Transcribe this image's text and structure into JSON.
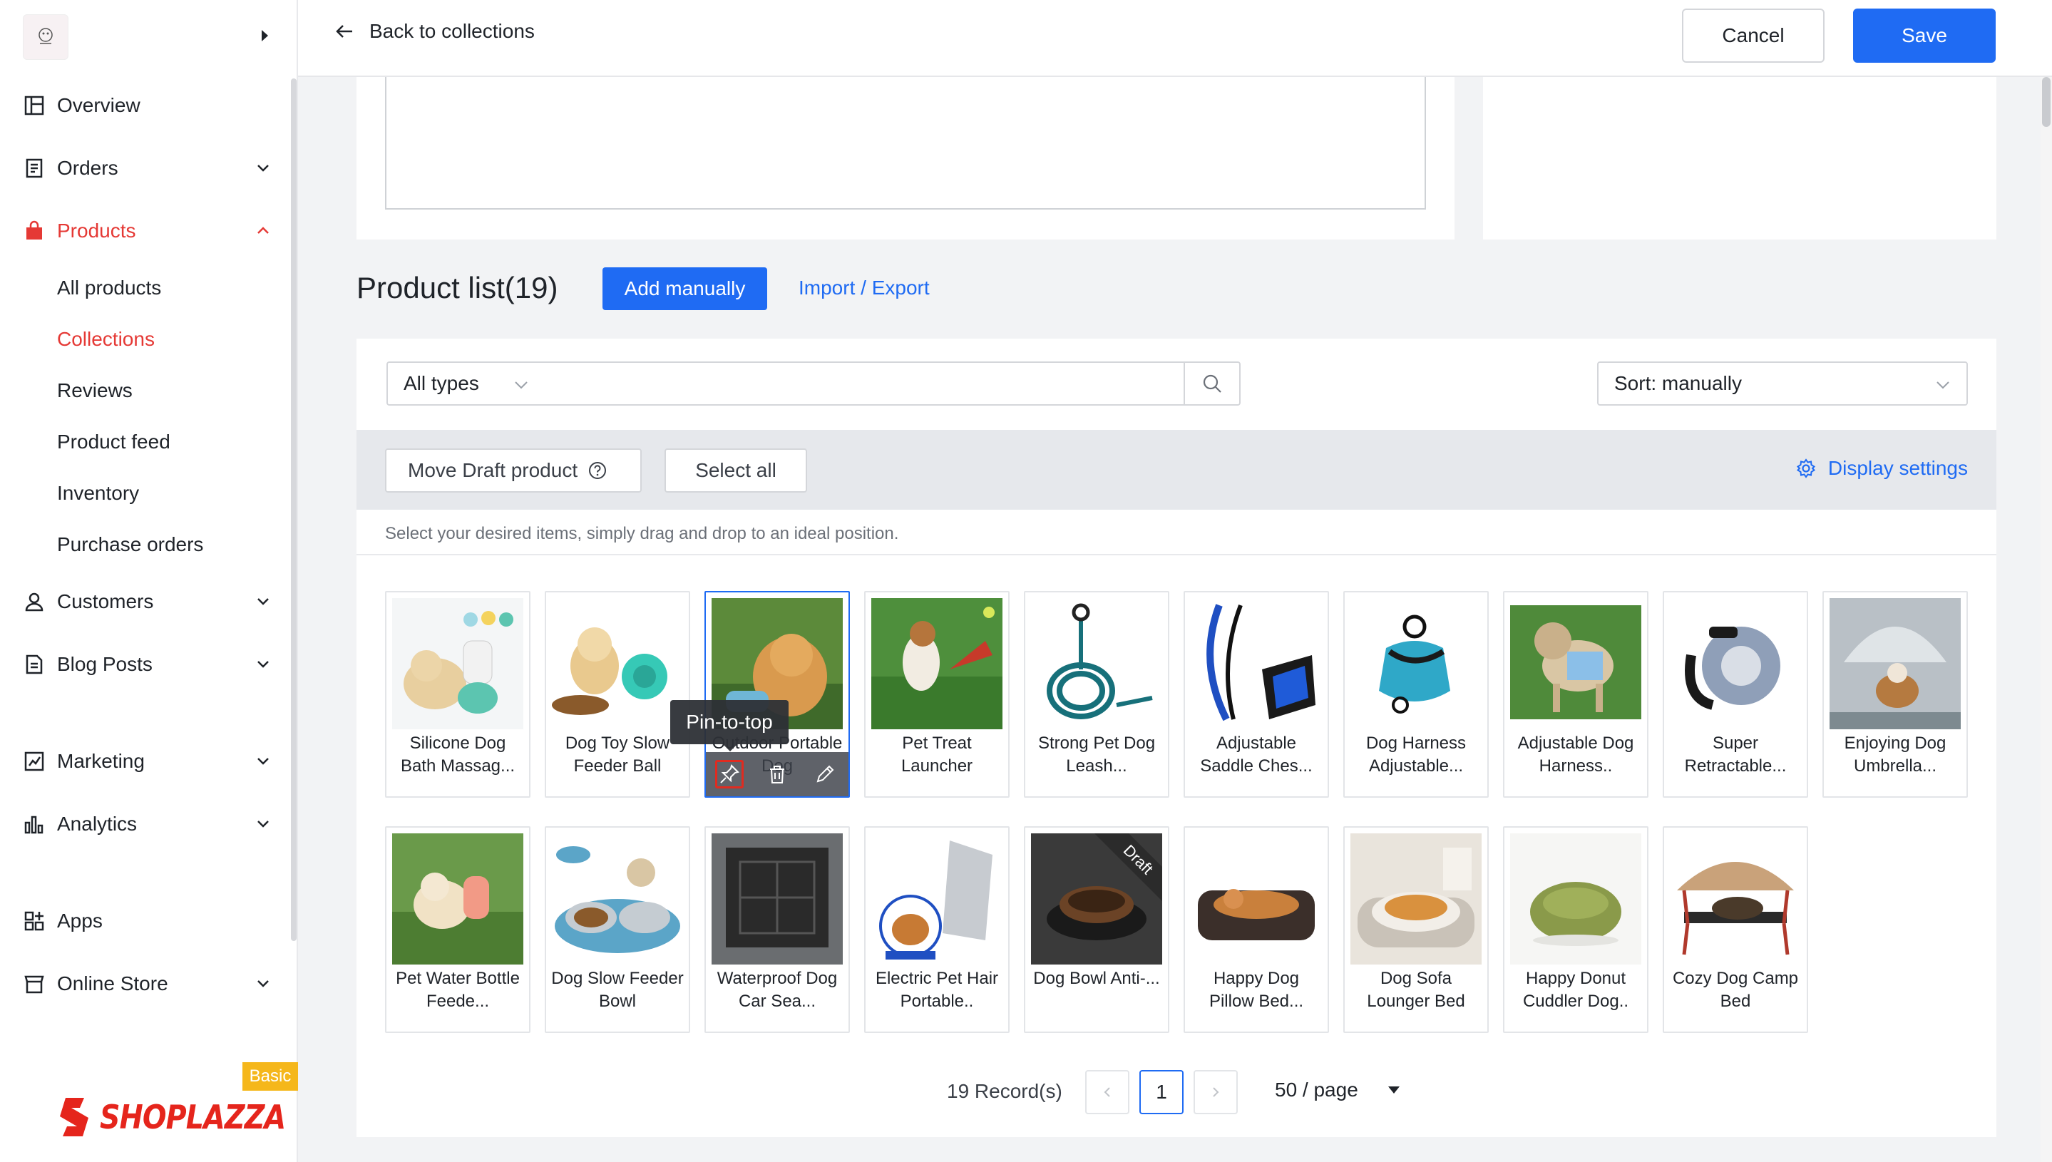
{
  "header": {
    "back_label": "Back to collections",
    "cancel_label": "Cancel",
    "save_label": "Save"
  },
  "sidebar": {
    "items": [
      {
        "label": "Overview",
        "icon": "overview-icon"
      },
      {
        "label": "Orders",
        "icon": "orders-icon",
        "expandable": true
      },
      {
        "label": "Products",
        "icon": "products-icon",
        "expanded": true,
        "active": true
      },
      {
        "label": "Customers",
        "icon": "customers-icon",
        "expandable": true
      },
      {
        "label": "Blog Posts",
        "icon": "blog-icon",
        "expandable": true
      },
      {
        "label": "Marketing",
        "icon": "marketing-icon",
        "expandable": true
      },
      {
        "label": "Analytics",
        "icon": "analytics-icon",
        "expandable": true
      },
      {
        "label": "Apps",
        "icon": "apps-icon"
      },
      {
        "label": "Online Store",
        "icon": "store-icon",
        "expandable": true
      }
    ],
    "product_subitems": [
      "All products",
      "Collections",
      "Reviews",
      "Product feed",
      "Inventory",
      "Purchase orders"
    ],
    "active_subitem": "Collections",
    "brand": "SHOPLAZZA",
    "plan_badge": "Basic"
  },
  "product_list": {
    "title": "Product list(19)",
    "add_label": "Add manually",
    "import_label": "Import / Export",
    "type_filter": "All types",
    "search_placeholder": "",
    "sort_label": "Sort: manually",
    "move_draft_label": "Move Draft product",
    "select_all_label": "Select all",
    "display_settings_label": "Display settings",
    "hint": "Select your desired items, simply drag and drop to an ideal position.",
    "tooltip": "Pin-to-top",
    "products": [
      {
        "name": "Silicone Dog Bath Massag...",
        "draft": false
      },
      {
        "name": "Dog Toy Slow Feeder Ball",
        "draft": false
      },
      {
        "name": "Outdoor Portable Dog",
        "draft": false,
        "selected": true
      },
      {
        "name": "Pet Treat Launcher",
        "draft": false
      },
      {
        "name": "Strong Pet Dog Leash...",
        "draft": false
      },
      {
        "name": "Adjustable Saddle Ches...",
        "draft": false
      },
      {
        "name": "Dog Harness Adjustable...",
        "draft": false
      },
      {
        "name": "Adjustable Dog Harness..",
        "draft": false
      },
      {
        "name": "Super Retractable...",
        "draft": false
      },
      {
        "name": "Enjoying Dog Umbrella...",
        "draft": false
      },
      {
        "name": "Pet Water Bottle Feede...",
        "draft": false
      },
      {
        "name": "Dog Slow Feeder Bowl",
        "draft": false
      },
      {
        "name": "Waterproof Dog Car Sea...",
        "draft": false
      },
      {
        "name": "Electric Pet Hair Portable..",
        "draft": false
      },
      {
        "name": "Dog Bowl Anti-...",
        "draft": true,
        "draft_label": "Draft"
      },
      {
        "name": "Happy Dog Pillow Bed...",
        "draft": false
      },
      {
        "name": "Dog Sofa Lounger Bed",
        "draft": false
      },
      {
        "name": "Happy Donut Cuddler Dog..",
        "draft": false
      },
      {
        "name": "Cozy Dog Camp Bed",
        "draft": false
      }
    ]
  },
  "pagination": {
    "records": "19 Record(s)",
    "current_page": "1",
    "per_page": "50 / page"
  },
  "colors": {
    "accent": "#1f6bf3",
    "brand_red": "#e5251c",
    "active_nav": "#e53935",
    "badge": "#f5b71b"
  }
}
